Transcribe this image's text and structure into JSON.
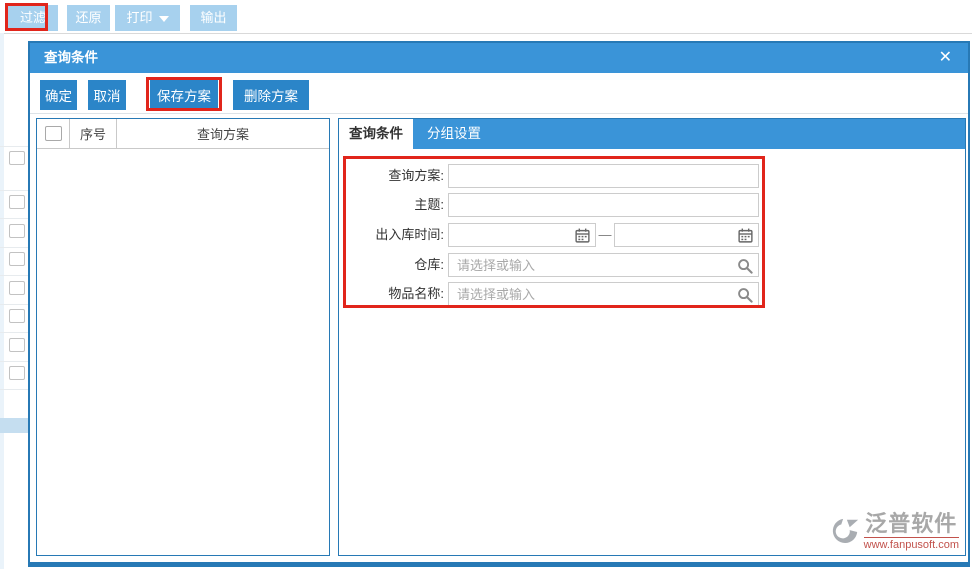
{
  "toolbar": {
    "buttons": [
      {
        "label": "过滤"
      },
      {
        "label": "还原"
      },
      {
        "label": "打印"
      },
      {
        "label": "输出"
      }
    ]
  },
  "modal": {
    "title": "查询条件",
    "close_icon": "✕",
    "actions": [
      {
        "label": "确定"
      },
      {
        "label": "取消"
      },
      {
        "label": "保存方案"
      },
      {
        "label": "删除方案"
      }
    ],
    "plan_list": {
      "columns": {
        "index": "序号",
        "plan": "查询方案"
      },
      "rows": []
    },
    "tabs": [
      {
        "label": "查询条件",
        "active": true
      },
      {
        "label": "分组设置",
        "active": false
      }
    ],
    "form": {
      "fields": [
        {
          "label": "查询方案:",
          "type": "text",
          "value": ""
        },
        {
          "label": "主题:",
          "type": "text",
          "value": ""
        },
        {
          "label": "出入库时间:",
          "type": "daterange",
          "separator": "—",
          "value_from": "",
          "value_to": ""
        },
        {
          "label": "仓库:",
          "type": "search",
          "placeholder": "请选择或输入",
          "value": ""
        },
        {
          "label": "物品名称:",
          "type": "search",
          "placeholder": "请选择或输入",
          "value": ""
        }
      ]
    }
  },
  "watermark": {
    "name": "泛普软件",
    "url": "www.fanpusoft.com"
  },
  "colors": {
    "header_blue": "#3a94d8",
    "button_blue": "#2b85c8",
    "toolbar_button_blue": "#a7d1ee",
    "panel_border_blue": "#2779b5",
    "annotation_red": "#e1251b",
    "watermark_red": "#c2524c"
  }
}
